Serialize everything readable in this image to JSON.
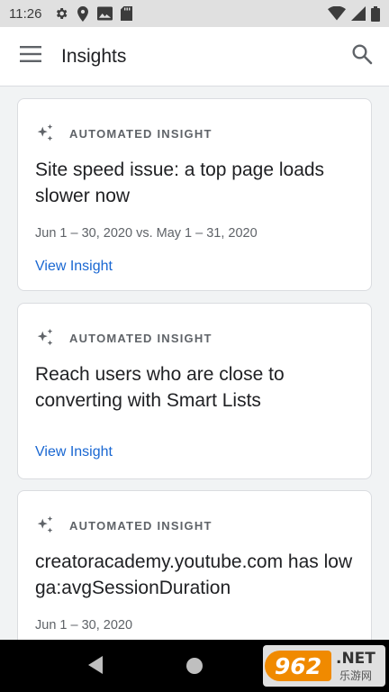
{
  "status_bar": {
    "time": "11:26",
    "left_icons": [
      "gear-icon",
      "location-icon",
      "image-icon",
      "sd-card-icon"
    ],
    "right_icons": [
      "wifi-icon",
      "signal-icon",
      "battery-icon"
    ]
  },
  "app_bar": {
    "title": "Insights",
    "menu_icon": "hamburger-menu-icon",
    "search_icon": "search-icon"
  },
  "cards": [
    {
      "label": "AUTOMATED INSIGHT",
      "headline": "Site speed issue: a top page loads slower now",
      "date_range": "Jun 1 – 30, 2020 vs. May 1 – 31, 2020",
      "link": "View Insight"
    },
    {
      "label": "AUTOMATED INSIGHT",
      "headline": "Reach users who are close to converting with Smart Lists",
      "date_range": "",
      "link": "View Insight"
    },
    {
      "label": "AUTOMATED INSIGHT",
      "headline": "creatoracademy.youtube.com has low ga:avgSessionDuration",
      "date_range": "Jun 1 – 30, 2020",
      "link": ""
    }
  ],
  "nav_bar": {
    "back_icon": "back-triangle-icon",
    "home_icon": "home-circle-icon"
  },
  "watermark": {
    "badge": "962",
    "net": ".NET",
    "cn": "乐游网"
  },
  "colors": {
    "accent": "#1967d2",
    "background": "#f1f3f4",
    "status_bar": "#e0e0e0"
  }
}
